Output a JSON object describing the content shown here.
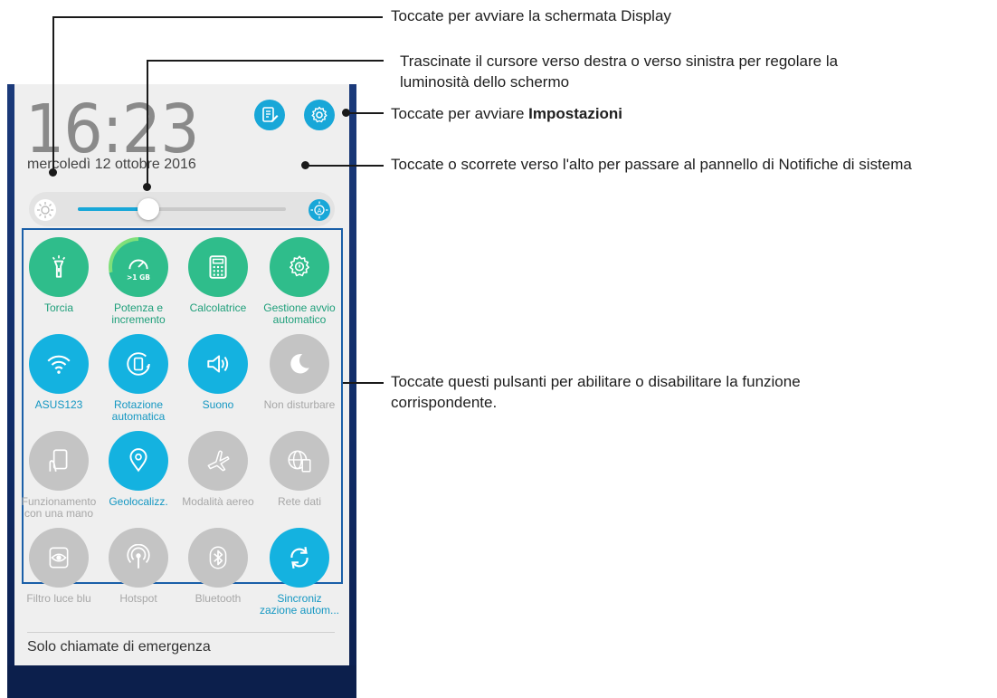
{
  "phone": {
    "time": "16:23",
    "date": "mercoledì 12 ottobre 2016",
    "emergency_text": "Solo chiamate di emergenza",
    "tiles": [
      {
        "label": "Torcia",
        "state": "green",
        "icon": "flashlight-icon"
      },
      {
        "label": "Potenza e\nincremento",
        "state": "green",
        "icon": "boost-gauge-icon",
        "badge": ">1 GB"
      },
      {
        "label": "Calcolatrice",
        "state": "green",
        "icon": "calculator-icon"
      },
      {
        "label": "Gestione avvio\nautomatico",
        "state": "green",
        "icon": "auto-start-gear-icon"
      },
      {
        "label": "ASUS123",
        "state": "blue",
        "icon": "wifi-icon"
      },
      {
        "label": "Rotazione\nautomatica",
        "state": "blue",
        "icon": "auto-rotate-icon"
      },
      {
        "label": "Suono",
        "state": "blue",
        "icon": "speaker-icon"
      },
      {
        "label": "Non disturbare",
        "state": "grey",
        "icon": "moon-icon"
      },
      {
        "label": "Funzionamento\ncon una mano",
        "state": "grey",
        "icon": "one-hand-icon"
      },
      {
        "label": "Geolocalizz.",
        "state": "blue",
        "icon": "location-pin-icon"
      },
      {
        "label": "Modalità aereo",
        "state": "grey",
        "icon": "airplane-icon"
      },
      {
        "label": "Rete dati",
        "state": "grey",
        "icon": "globe-phone-icon"
      },
      {
        "label": "Filtro luce blu",
        "state": "grey",
        "icon": "eye-icon"
      },
      {
        "label": "Hotspot",
        "state": "grey",
        "icon": "hotspot-icon"
      },
      {
        "label": "Bluetooth",
        "state": "grey",
        "icon": "bluetooth-icon"
      },
      {
        "label": "Sincroniz\nzazione autom...",
        "state": "blue",
        "icon": "sync-icon"
      }
    ],
    "brightness_level": 0.34
  },
  "callouts": {
    "display": "Toccate per avviare la schermata Display",
    "slider": "Trascinate il cursore verso destra o verso sinistra per regolare la luminosità dello schermo",
    "settings_prefix": "Toccate per avviare ",
    "settings_bold": "Impostazioni",
    "notifications": "Toccate o scorrete verso l'alto per passare al pannello di Notifiche di sistema",
    "buttons": "Toccate questi pulsanti per abilitare o disabilitare la funzione corrispondente."
  }
}
